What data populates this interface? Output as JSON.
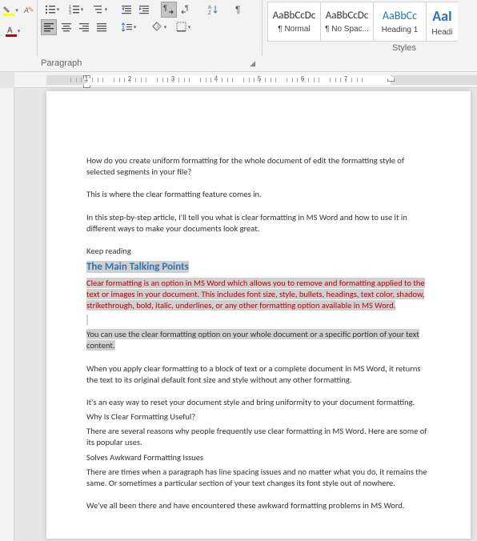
{
  "ribbon": {
    "paragraph_label": "Paragraph",
    "styles_label": "Styles"
  },
  "styles": [
    {
      "sample": "AaBbCcDc",
      "name": "¶ Normal"
    },
    {
      "sample": "AaBbCcDc",
      "name": "¶ No Spac..."
    },
    {
      "sample": "AaBbCc",
      "name": "Heading 1"
    },
    {
      "sample": "AaI",
      "name": "Headi"
    }
  ],
  "ruler": {
    "nums": [
      "1",
      "2",
      "3",
      "4",
      "5",
      "6",
      "7"
    ]
  },
  "doc": {
    "p1": "How do you create uniform formatting for the whole document of edit the formatting style of selected segments in your file?",
    "p2": "This is where the clear formatting feature comes in.",
    "p3": "In this step-by-step article, I'll tell you what is clear formatting in MS Word and how to use it in different ways to make your documents look great.",
    "p4": "Keep reading",
    "h1": "The Main Talking Points",
    "p5": "Clear formatting is an option in MS Word which allows you to remove and formatting applied to the text or images in your document. This includes font size, style, bullets, headings, text color, shadow, strikethrough, bold, italic, underlines, or any other formatting option available in MS Word.",
    "p6": "You can use the clear formatting option on your whole document or a specific portion of your text content.",
    "p7": "When you apply clear formatting to a block of text or a complete document in MS Word, it returns the text to its original default font size and style without any other formatting.",
    "p8": "It's an easy way to reset your document style and bring uniformity to your document formatting.",
    "p9": "Why Is Clear Formatting Useful?",
    "p10": "There are several reasons why people frequently use clear formatting in MS Word. Here are some of its popular uses.",
    "p11": "Solves Awkward Formatting Issues",
    "p12": "There are times when a paragraph has line spacing issues and no matter what you do, it remains the same. Or sometimes a particular section of your text changes its font style out of nowhere.",
    "p13": "We've all been there and have encountered these awkward formatting problems in MS Word."
  }
}
